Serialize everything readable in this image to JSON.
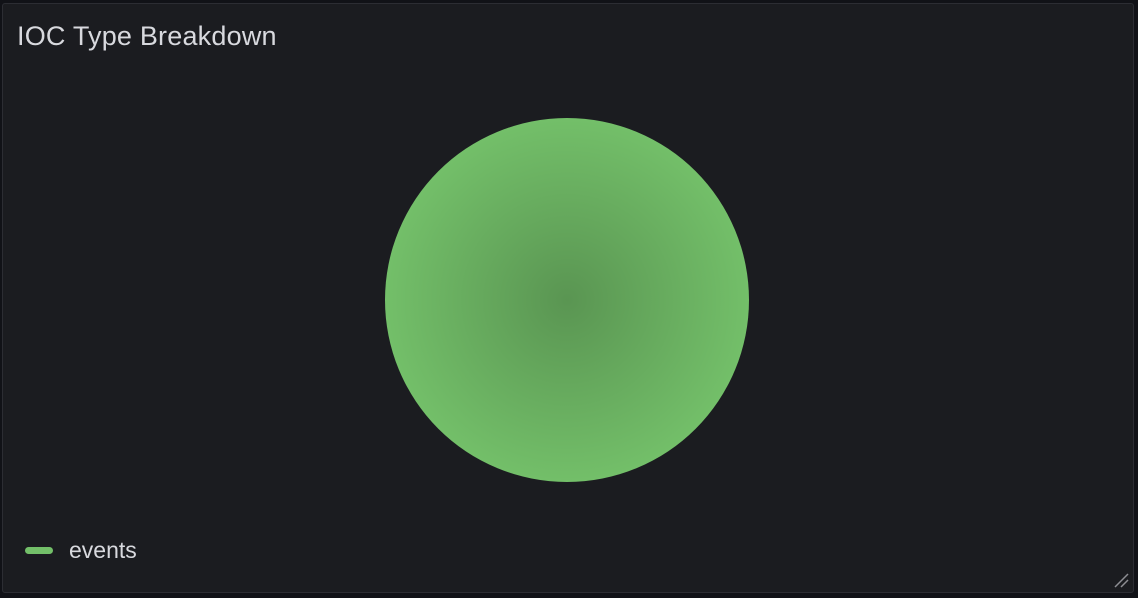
{
  "panel": {
    "title": "IOC Type Breakdown"
  },
  "chart_data": {
    "type": "pie",
    "title": "IOC Type Breakdown",
    "slices": [
      {
        "label": "events",
        "value": 1,
        "color": "#73bf69"
      }
    ],
    "legend": {
      "placement": "bottom-left",
      "entries": [
        "events"
      ]
    }
  },
  "icons": {
    "resize": "resize-handle-icon"
  }
}
